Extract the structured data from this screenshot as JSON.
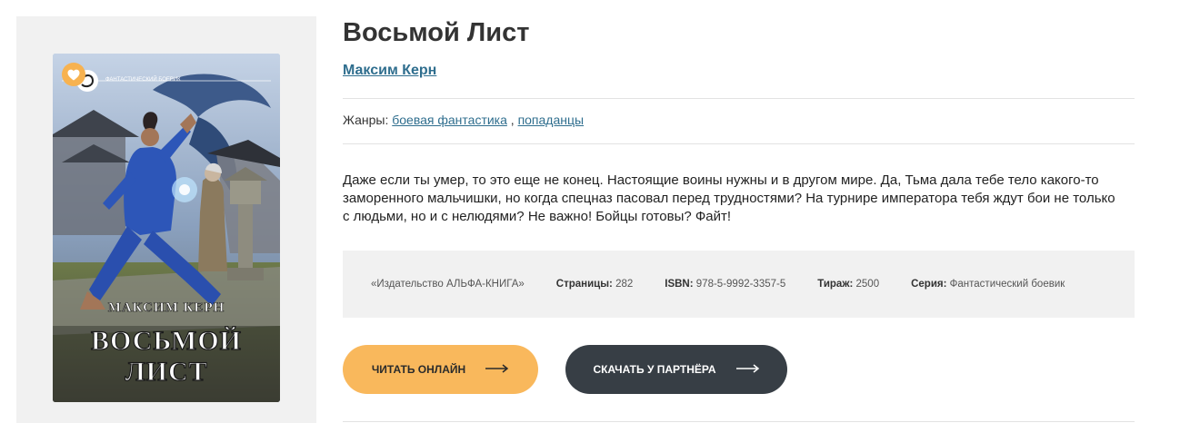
{
  "book": {
    "title": "Восьмой Лист",
    "author": "Максим Керн",
    "genres_label": "Жанры:",
    "genres": [
      "боевая фантастика",
      "попаданцы"
    ],
    "genre_separator": ",",
    "description": "Даже если ты умер, то это еще не конец. Настоящие воины нужны и в другом мире. Да, Тьма дала тебе тело какого-то заморенного мальчишки, но когда спецназ пасовал перед трудностями? На турнире императора тебя ждут бои не только с людьми, но и с нелюдями? Не важно! Бойцы готовы? Файт!"
  },
  "cover": {
    "series_badge": "ФАНТАСТИЧЕСКИЙ БОЕВИК",
    "author": "МАКСИМ КЕРН",
    "title_line1": "ВОСЬМОЙ",
    "title_line2": "ЛИСТ",
    "favorite_icon": "heart-icon",
    "favorite_color": "#f7b250"
  },
  "meta": {
    "publisher": "«Издательство АЛЬФА-КНИГА»",
    "pages_label": "Страницы:",
    "pages_value": "282",
    "isbn_label": "ISBN:",
    "isbn_value": "978-5-9992-3357-5",
    "print_label": "Тираж:",
    "print_value": "2500",
    "series_label": "Серия:",
    "series_value": "Фантастический боевик"
  },
  "actions": {
    "read_label": "Читать онлайн",
    "download_label": "Скачать у партнёра",
    "arrow_icon": "arrow-right-icon",
    "read_color": "#f9b85c",
    "download_color": "#373e45"
  }
}
